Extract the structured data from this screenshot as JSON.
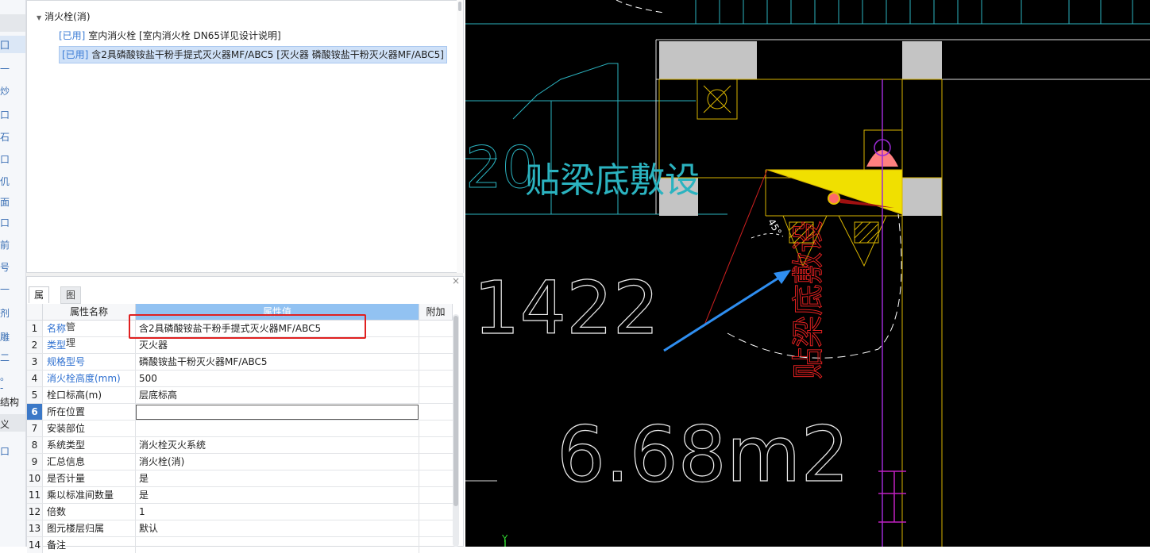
{
  "left_strip": {
    "glyphs": [
      "囗",
      "一",
      "炒",
      "口",
      "石",
      "口",
      "仉",
      "面",
      "口",
      "前",
      "号",
      "一",
      "剂",
      "雕",
      "二",
      "。",
      "-",
      "口"
    ],
    "label_1": "结构",
    "label_2": "义"
  },
  "tree": {
    "root_label": "消火栓(消)",
    "items": [
      {
        "badge": "[已用]",
        "text": "室内消火栓 [室内消火栓 DN65详见设计说明]"
      },
      {
        "badge": "[已用]",
        "text": "含2具磷酸铵盐干粉手提式灭火器MF/ABC5 [灭火器 磷酸铵盐干粉灭火器MF/ABC5]"
      }
    ]
  },
  "props": {
    "close_label": "×",
    "tab_attr": "属性",
    "tab_layer": "图层管理",
    "col_name": "属性名称",
    "col_value": "属性值",
    "col_add": "附加",
    "rows": [
      {
        "num": "1",
        "name": "名称",
        "value": "含2具磷酸铵盐干粉手提式灭火器MF/ABC5"
      },
      {
        "num": "2",
        "name": "类型",
        "value": "灭火器"
      },
      {
        "num": "3",
        "name": "规格型号",
        "value": "磷酸铵盐干粉灭火器MF/ABC5"
      },
      {
        "num": "4",
        "name": "消火栓高度(mm)",
        "value": "500"
      },
      {
        "num": "5",
        "name": "栓口标高(m)",
        "value": "层底标高"
      },
      {
        "num": "6",
        "name": "所在位置",
        "value": ""
      },
      {
        "num": "7",
        "name": "安装部位",
        "value": ""
      },
      {
        "num": "8",
        "name": "系统类型",
        "value": "消火栓灭火系统"
      },
      {
        "num": "9",
        "name": "汇总信息",
        "value": "消火栓(消)"
      },
      {
        "num": "10",
        "name": "是否计量",
        "value": "是"
      },
      {
        "num": "11",
        "name": "乘以标准间数量",
        "value": "是"
      },
      {
        "num": "12",
        "name": "倍数",
        "value": "1"
      },
      {
        "num": "13",
        "name": "图元楼层归属",
        "value": "默认"
      },
      {
        "num": "14",
        "name": "备注",
        "value": ""
      }
    ]
  },
  "cad": {
    "label_beam": "贴梁底敷设",
    "label_num": "1422",
    "label_area": "6.68m2",
    "label_red": "贴梁底敷设",
    "label_angle": "45°",
    "label_left": "20",
    "axis_y": "Y"
  }
}
